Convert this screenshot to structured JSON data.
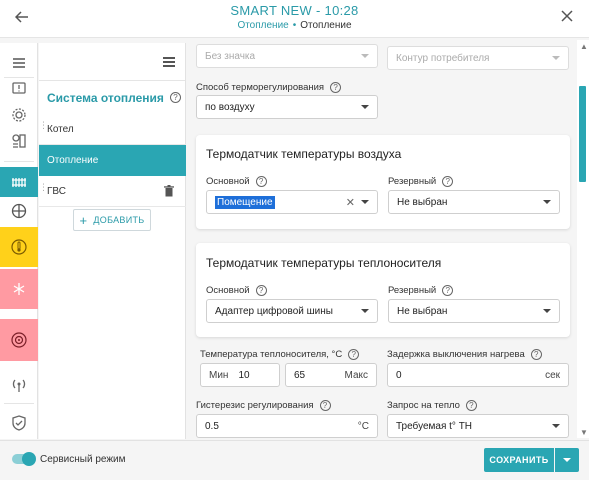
{
  "header": {
    "title": "SMART NEW - 10:28",
    "breadcrumb_link": "Отопление",
    "breadcrumb_current": "Отопление"
  },
  "panel": {
    "title": "Система отопления",
    "items": [
      {
        "label": "Котел"
      },
      {
        "label": "Отопление"
      },
      {
        "label": "ГВС"
      }
    ],
    "add_label": "ДОБАВИТЬ"
  },
  "main": {
    "top_left_select": "Без значка",
    "top_right_select": "Контур потребителя",
    "regulation_label": "Способ терморегулирования",
    "regulation_value": "по воздуху",
    "air_sensor": {
      "title": "Термодатчик температуры воздуха",
      "main_label": "Основной",
      "main_value": "Помещение",
      "reserve_label": "Резервный",
      "reserve_value": "Не выбран"
    },
    "carrier_sensor": {
      "title": "Термодатчик температуры теплоносителя",
      "main_label": "Основной",
      "main_value": "Адаптер цифровой шины",
      "reserve_label": "Резервный",
      "reserve_value": "Не выбран"
    },
    "carrier_temp_label": "Температура теплоносителя, °C",
    "min_prefix": "Мин",
    "min_value": "10",
    "max_value": "65",
    "max_suffix": "Макс",
    "delay_label": "Задержка выключения нагрева",
    "delay_value": "0",
    "delay_suffix": "сек",
    "hysteresis_label": "Гистерезис регулирования",
    "hysteresis_value": "0.5",
    "hysteresis_suffix": "°C",
    "heat_request_label": "Запрос на тепло",
    "heat_request_value": "Требуемая t° ТН"
  },
  "footer": {
    "service_mode_label": "Сервисный режим",
    "service_mode_on": true,
    "save_label": "СОХРАНИТЬ"
  },
  "colors": {
    "accent": "#2aa6b3",
    "rail_yellow": "#ffd11a",
    "rail_pink": "#ff9aa2"
  }
}
